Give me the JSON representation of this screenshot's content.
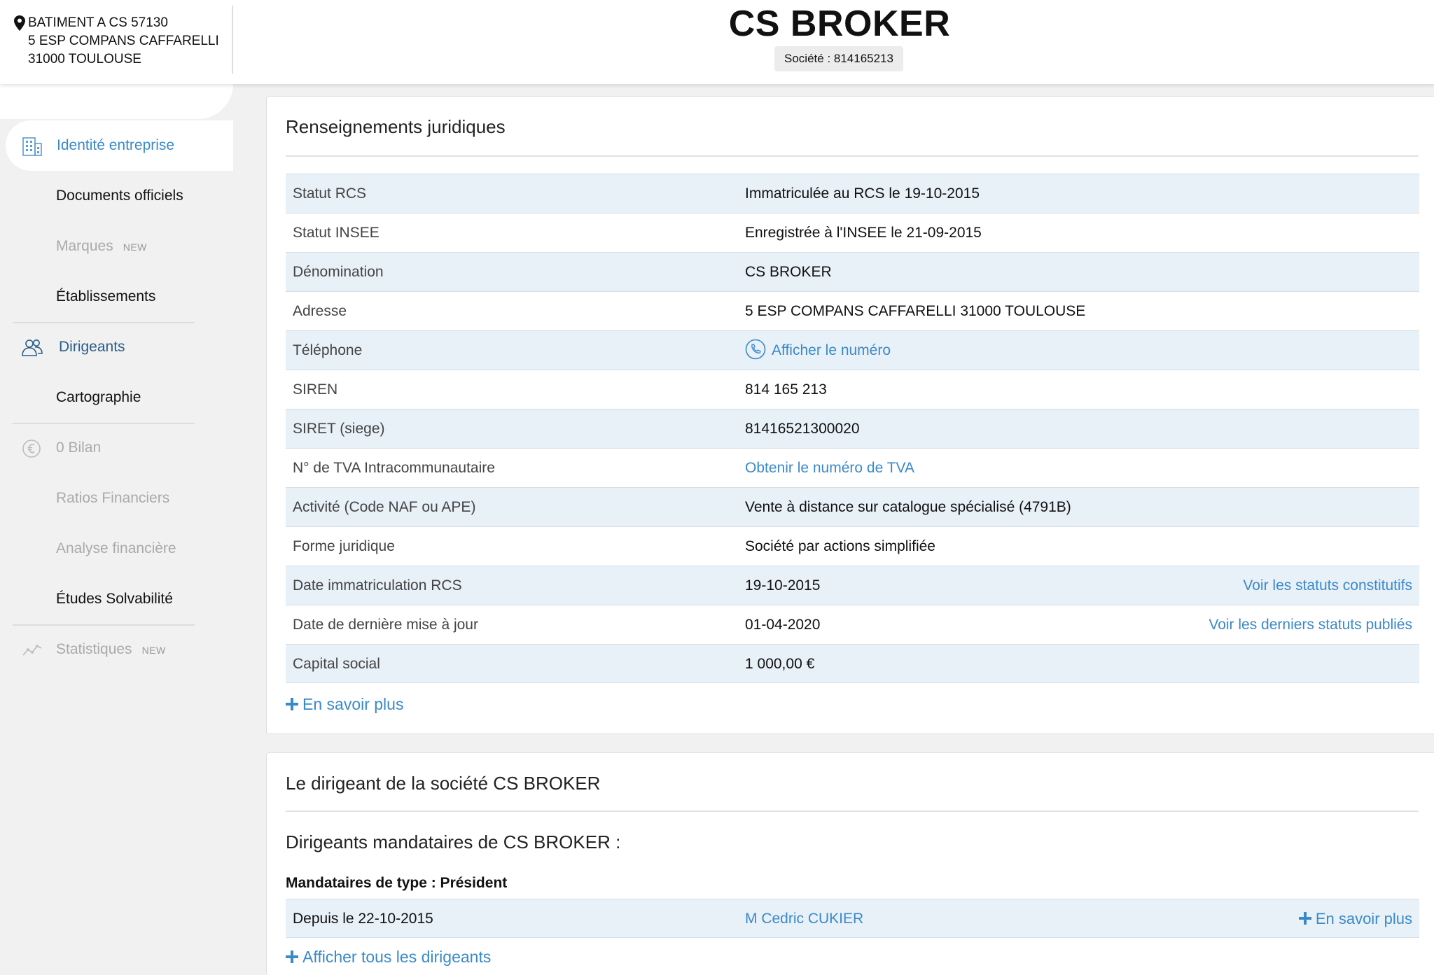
{
  "header": {
    "address_lines": [
      "BATIMENT A CS 57130",
      "5 ESP COMPANS CAFFARELLI",
      "31000 TOULOUSE"
    ],
    "company_name": "CS BROKER",
    "company_id": "Société : 814165213"
  },
  "sidebar": {
    "items": [
      {
        "label": "Identité entreprise",
        "state": "active",
        "icon": "building-icon"
      },
      {
        "label": "Documents officiels",
        "state": "normal"
      },
      {
        "label": "Marques",
        "badge": "NEW",
        "state": "disabled"
      },
      {
        "label": "Établissements",
        "state": "normal"
      },
      {
        "label": "Dirigeants",
        "state": "section",
        "icon": "people-icon"
      },
      {
        "label": "Cartographie",
        "state": "normal"
      },
      {
        "label": "0 Bilan",
        "state": "disabled",
        "icon": "euro-icon"
      },
      {
        "label": "Ratios Financiers",
        "state": "disabled"
      },
      {
        "label": "Analyse financière",
        "state": "disabled"
      },
      {
        "label": "Études Solvabilité",
        "state": "normal"
      },
      {
        "label": "Statistiques",
        "badge": "NEW",
        "state": "disabled",
        "icon": "chart-line-icon"
      }
    ]
  },
  "legal": {
    "title": "Renseignements juridiques",
    "rows": [
      {
        "label": "Statut RCS",
        "value": "Immatriculée au RCS le 19-10-2015"
      },
      {
        "label": "Statut INSEE",
        "value": "Enregistrée à l'INSEE le 21-09-2015"
      },
      {
        "label": "Dénomination",
        "value": "CS BROKER"
      },
      {
        "label": "Adresse",
        "value": "5 ESP COMPANS CAFFARELLI 31000 TOULOUSE"
      },
      {
        "label": "Téléphone",
        "value": "Afficher le numéro"
      },
      {
        "label": "SIREN",
        "value": "814 165 213"
      },
      {
        "label": "SIRET (siege)",
        "value": "81416521300020"
      },
      {
        "label": "N° de TVA Intracommunautaire",
        "value": "Obtenir le numéro de TVA"
      },
      {
        "label": "Activité (Code NAF ou APE)",
        "value": "Vente à distance sur catalogue spécialisé (4791B)"
      },
      {
        "label": "Forme juridique",
        "value": "Société par actions simplifiée"
      },
      {
        "label": "Date immatriculation RCS",
        "value": "19-10-2015",
        "action": "Voir les statuts constitutifs"
      },
      {
        "label": "Date de dernière mise à jour",
        "value": "01-04-2020",
        "action": "Voir les derniers statuts publiés"
      },
      {
        "label": "Capital social",
        "value": "1 000,00 €"
      }
    ],
    "more_label": "En savoir plus"
  },
  "directors": {
    "title": "Le dirigeant de la société CS BROKER",
    "subtitle": "Dirigeants mandataires de CS BROKER :",
    "type_label": "Mandataires de type : Président",
    "row": {
      "since": "Depuis le 22-10-2015",
      "name": "M Cedric CUKIER",
      "more": "En savoir plus"
    },
    "show_all": "Afficher tous les dirigeants"
  },
  "colors": {
    "link": "#3a8ac8",
    "row_alt": "#e8f0f8",
    "sidebar_bg": "#f1f1f1"
  }
}
